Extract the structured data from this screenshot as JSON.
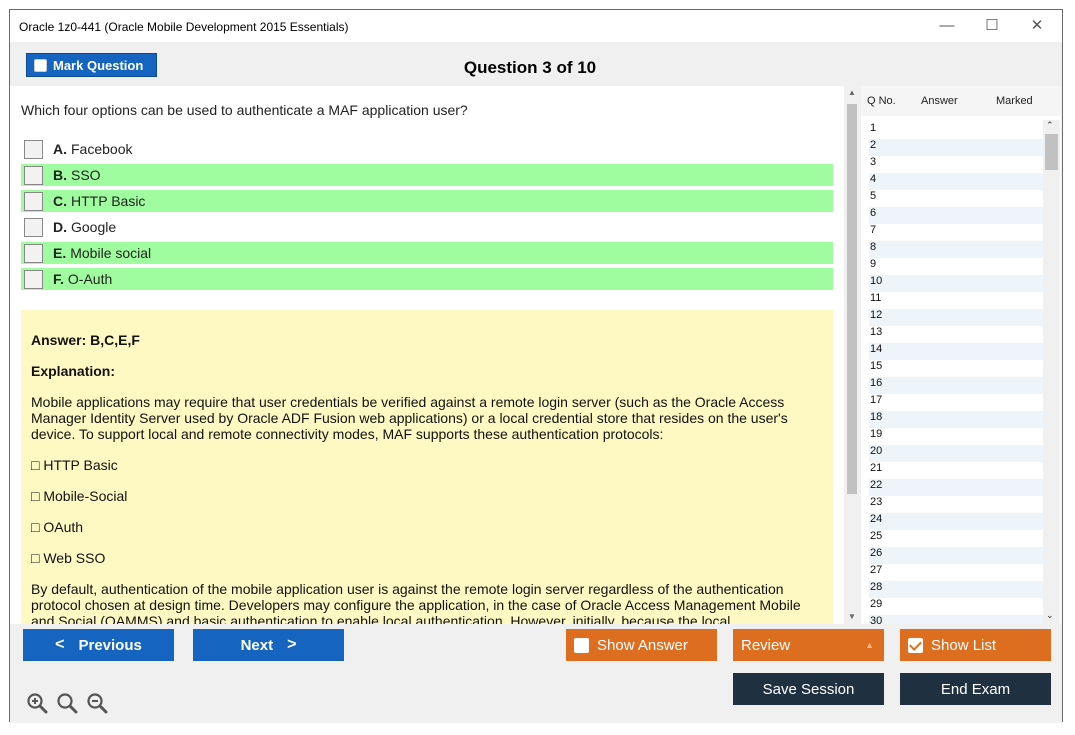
{
  "window": {
    "title": "Oracle 1z0-441 (Oracle Mobile Development 2015 Essentials)",
    "minimize": "—",
    "maximize": "☐",
    "close": "✕"
  },
  "toolbar": {
    "mark_label": "Mark Question",
    "question_header": "Question 3 of 10"
  },
  "question": {
    "text": "Which four options can be used to authenticate a MAF application user?",
    "options": [
      {
        "letter": "A.",
        "text": "Facebook",
        "correct": false
      },
      {
        "letter": "B.",
        "text": "SSO",
        "correct": true
      },
      {
        "letter": "C.",
        "text": "HTTP Basic",
        "correct": true
      },
      {
        "letter": "D.",
        "text": "Google",
        "correct": false
      },
      {
        "letter": "E.",
        "text": "Mobile social",
        "correct": true
      },
      {
        "letter": "F.",
        "text": "O-Auth",
        "correct": true
      }
    ]
  },
  "answer": {
    "answer_line": "Answer: B,C,E,F",
    "explanation_label": "Explanation:",
    "para1": "Mobile applications may require that user credentials be verified against a remote login server (such as the Oracle Access Manager Identity Server used by Oracle ADF Fusion web applications) or a local credential store that resides on the user's device. To support local and remote connectivity modes, MAF supports these authentication protocols:",
    "bullets": [
      "□ HTTP Basic",
      "□ Mobile-Social",
      "□ OAuth",
      "□ Web SSO"
    ],
    "para2": "By default, authentication of the mobile application user is against the remote login server regardless of the authentication protocol chosen at design time. Developers may configure the application, in the case of Oracle Access Management Mobile and Social (OAMMS) and basic authentication to enable local authentication. However, initially, because the local"
  },
  "list": {
    "col_qno": "Q No.",
    "col_answer": "Answer",
    "col_marked": "Marked",
    "numbers": [
      "1",
      "2",
      "3",
      "4",
      "5",
      "6",
      "7",
      "8",
      "9",
      "10",
      "11",
      "12",
      "13",
      "14",
      "15",
      "16",
      "17",
      "18",
      "19",
      "20",
      "21",
      "22",
      "23",
      "24",
      "25",
      "26",
      "27",
      "28",
      "29",
      "30"
    ]
  },
  "buttons": {
    "previous": "Previous",
    "next": "Next",
    "show_answer": "Show Answer",
    "review": "Review",
    "show_list": "Show List",
    "save_session": "Save Session",
    "end_exam": "End Exam"
  },
  "colors": {
    "primary_blue": "#1565c0",
    "accent_orange": "#dd6e1f",
    "dark_navy": "#1f3040",
    "correct_green": "#9ffd9f",
    "answer_yellow": "#fef9c2"
  },
  "icons": {
    "zoom_in": "zoom-in-icon",
    "zoom_reset": "zoom-reset-icon",
    "zoom_out": "zoom-out-icon"
  }
}
